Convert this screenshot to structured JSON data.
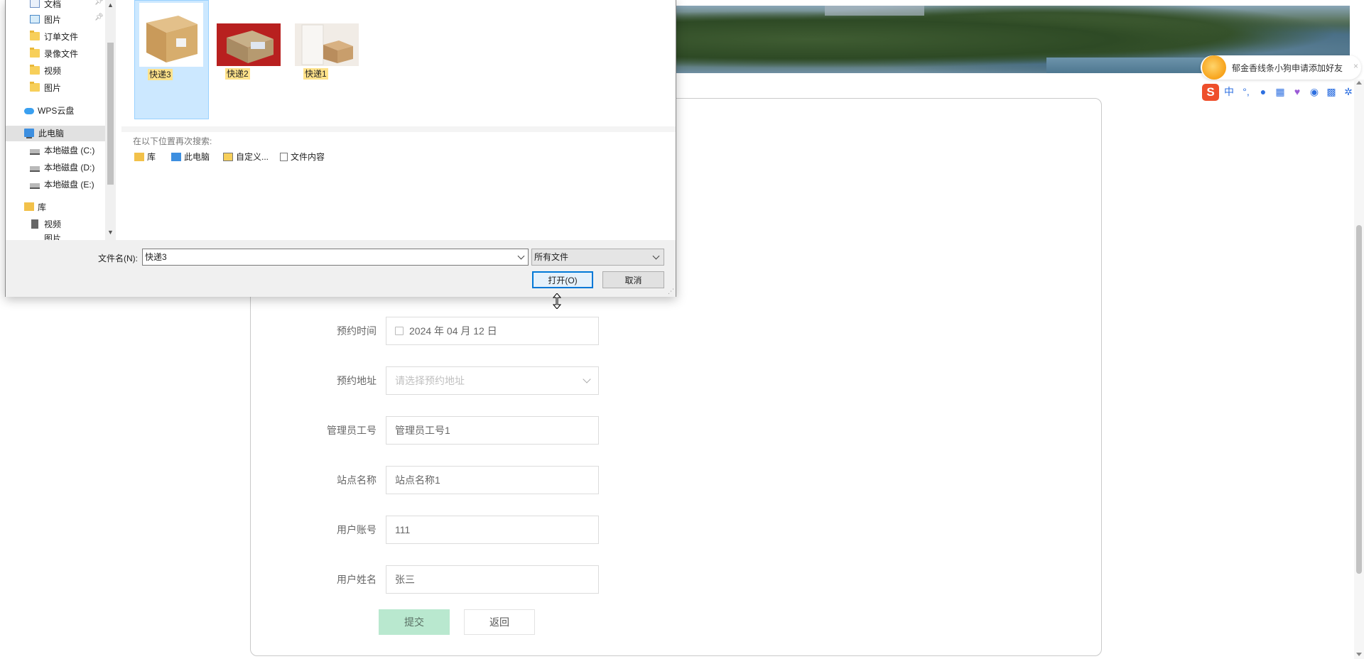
{
  "page": {
    "form": {
      "rows": [
        {
          "label": "预约时间",
          "value": "2024 年 04 月 12 日",
          "kind": "date"
        },
        {
          "label": "预约地址",
          "placeholder": "请选择预约地址",
          "kind": "select"
        },
        {
          "label": "管理员工号",
          "value": "管理员工号1",
          "kind": "text"
        },
        {
          "label": "站点名称",
          "value": "站点名称1",
          "kind": "text"
        },
        {
          "label": "用户账号",
          "value": "111",
          "kind": "text"
        },
        {
          "label": "用户姓名",
          "value": "张三",
          "kind": "text"
        }
      ],
      "submit_label": "提交",
      "back_label": "返回"
    },
    "ime": {
      "toast_text": "郁金香线条小狗申请添加好友",
      "close": "×",
      "logo": "S",
      "mode_label": "中",
      "icons": [
        "punctuation-icon",
        "microphone-icon",
        "keyboard-icon",
        "skin-icon",
        "game-icon",
        "grid-icon",
        "settings-icon"
      ]
    }
  },
  "dialog": {
    "nav": {
      "items": [
        {
          "label": "文档",
          "icon": "document-icon",
          "pinned": true
        },
        {
          "label": "图片",
          "icon": "pictures-icon",
          "pinned": true
        },
        {
          "label": "订单文件",
          "icon": "folder-icon"
        },
        {
          "label": "录像文件",
          "icon": "folder-icon"
        },
        {
          "label": "视频",
          "icon": "folder-icon"
        },
        {
          "label": "图片",
          "icon": "folder-icon"
        },
        {
          "label": "WPS云盘",
          "icon": "cloud-icon"
        },
        {
          "label": "此电脑",
          "icon": "computer-icon",
          "selected": true
        },
        {
          "label": "本地磁盘 (C:)",
          "icon": "drive-icon"
        },
        {
          "label": "本地磁盘 (D:)",
          "icon": "drive-icon"
        },
        {
          "label": "本地磁盘 (E:)",
          "icon": "drive-icon"
        },
        {
          "label": "库",
          "icon": "library-icon"
        },
        {
          "label": "视频",
          "icon": "video-icon"
        },
        {
          "label": "图片",
          "icon": "pictures-icon"
        }
      ]
    },
    "files": [
      {
        "name": "快递3",
        "selected": true
      },
      {
        "name": "快递2"
      },
      {
        "name": "快递1"
      }
    ],
    "search_again": {
      "title": "在以下位置再次搜索:",
      "links": [
        "库",
        "此电脑",
        "自定义...",
        "文件内容"
      ]
    },
    "filename_label": "文件名(N):",
    "filename_value": "快递3",
    "filetype_value": "所有文件",
    "open_label": "打开(O)",
    "cancel_label": "取消"
  },
  "colors": {
    "submit_bg": "#b9e8cf",
    "selection_bg": "#cce8ff",
    "primary_border": "#0078d7",
    "ime_logo": "#ee4f2b"
  }
}
